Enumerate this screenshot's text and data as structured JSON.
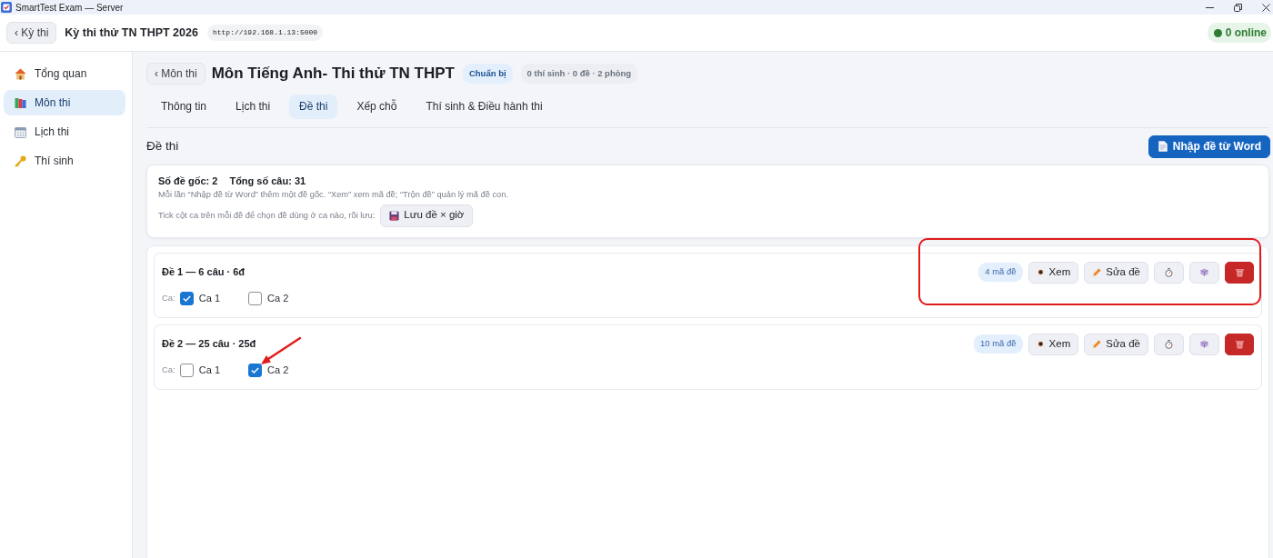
{
  "window": {
    "title": "SmartTest Exam — Server"
  },
  "header": {
    "back_button": "‹ Kỳ thi",
    "title": "Kỳ thi thử TN THPT 2026",
    "url": "http://192.168.1.13:5000",
    "online": "0 online"
  },
  "sidebar": {
    "items": [
      {
        "kind": "overview",
        "label": "Tổng quan",
        "selected": false
      },
      {
        "kind": "subjects",
        "label": "Môn thi",
        "selected": true
      },
      {
        "kind": "schedule",
        "label": "Lịch thi",
        "selected": false
      },
      {
        "kind": "candidates",
        "label": "Thí sinh",
        "selected": false
      }
    ]
  },
  "subject": {
    "back_button": "‹ Môn thi",
    "title": "Môn Tiếng Anh- Thi thử TN THPT",
    "status": "Chuẩn bị",
    "meta": "0 thí sinh · 0 đề · 2 phòng"
  },
  "tabs": [
    {
      "label": "Thông tin",
      "selected": false
    },
    {
      "label": "Lịch thi",
      "selected": false
    },
    {
      "label": "Đề thi",
      "selected": true
    },
    {
      "label": "Xếp chỗ",
      "selected": false
    },
    {
      "label": "Thí sinh & Điều hành thi",
      "selected": false
    }
  ],
  "section": {
    "title": "Đề thi",
    "import_button": "Nhập đề từ Word"
  },
  "summary": {
    "originals": "Số đề gốc: 2",
    "total_questions": "Tổng số câu: 31",
    "hint": "Mỗi lần “Nhập đề từ Word” thêm một đề gốc. “Xem” xem mã đề; “Trộn đề” quản lý mã đề con.",
    "save_hint": "Tick cột ca trên mỗi đề để chọn đề dùng ở ca nào, rồi lưu:",
    "save_button": "Lưu đề × giờ"
  },
  "exams": [
    {
      "title": "Đề 1 — 6 câu · 6đ",
      "shift_prefix": "Ca:",
      "shifts": [
        {
          "label": "Ca 1",
          "checked": true,
          "annotation_arrow": false
        },
        {
          "label": "Ca 2",
          "checked": false,
          "annotation_arrow": false
        }
      ],
      "codes": "4 mã đề",
      "view_button": "Xem",
      "edit_button": "Sửa đề",
      "annotation_box": true
    },
    {
      "title": "Đề 2 — 25 câu · 25đ",
      "shift_prefix": "Ca:",
      "shifts": [
        {
          "label": "Ca 1",
          "checked": false,
          "annotation_arrow": false
        },
        {
          "label": "Ca 2",
          "checked": true,
          "annotation_arrow": true
        }
      ],
      "codes": "10 mã đề",
      "view_button": "Xem",
      "edit_button": "Sửa đề",
      "annotation_box": false
    }
  ]
}
